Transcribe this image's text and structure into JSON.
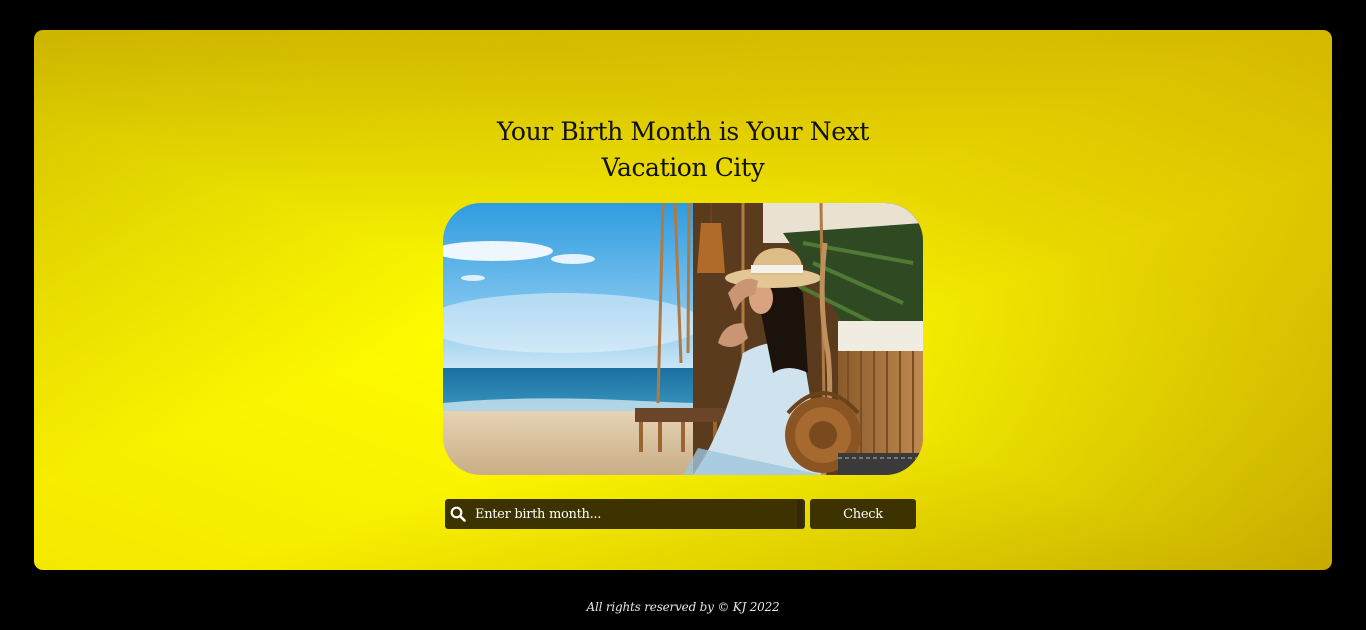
{
  "page": {
    "title_line1": "Your Birth Month is Your Next",
    "title_line2": "Vacation City"
  },
  "hero_image": {
    "alt": "Woman in a sun hat sitting on a rope swing at a beach bar"
  },
  "search": {
    "placeholder": "Enter birth month...",
    "value": "",
    "icon": "search-icon",
    "button_label": "Check"
  },
  "footer": {
    "text": "All rights reserved by © KJ 2022"
  },
  "colors": {
    "background": "#000000",
    "card_yellow": "#ffff00",
    "card_gold": "#c9a400",
    "control_dark": "#3d3300"
  }
}
